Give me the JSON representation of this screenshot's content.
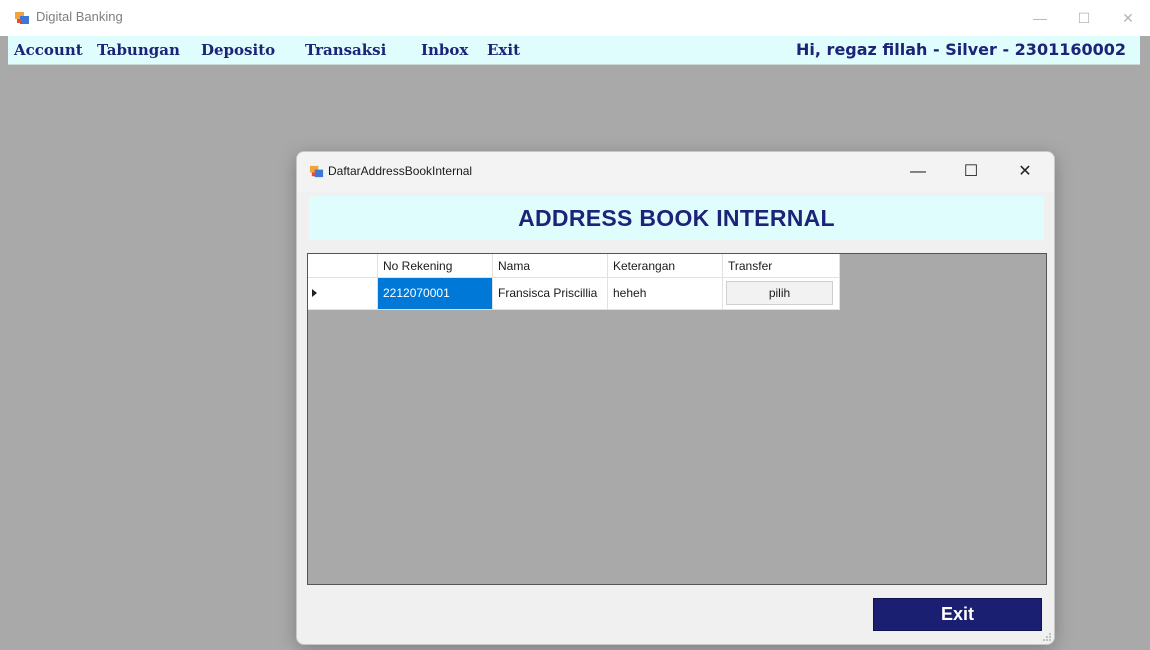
{
  "app": {
    "title": "Digital Banking",
    "window_buttons": {
      "minimize": "—",
      "maximize": "☐",
      "close": "✕"
    }
  },
  "menubar": {
    "items": [
      "Account",
      "Tabungan",
      "Deposito",
      "Transaksi",
      "Inbox",
      "Exit"
    ],
    "greeting": "Hi, regaz fillah - Silver - 2301160002"
  },
  "dialog": {
    "title": "DaftarAddressBookInternal",
    "buttons": {
      "minimize": "—",
      "maximize": "☐",
      "close": "✕"
    },
    "banner": "ADDRESS BOOK INTERNAL",
    "grid": {
      "columns": [
        "No Rekening",
        "Nama",
        "Keterangan",
        "Transfer"
      ],
      "rows": [
        {
          "no_rekening": "2212070001",
          "nama": "Fransisca Priscillia",
          "keterangan": "heheh",
          "transfer": "pilih"
        }
      ]
    },
    "exit_label": "Exit"
  },
  "colors": {
    "accent": "#1c2378",
    "banner_bg": "#e0fdfd",
    "selection": "#0078d7",
    "exit_bg": "#1a1f72"
  }
}
